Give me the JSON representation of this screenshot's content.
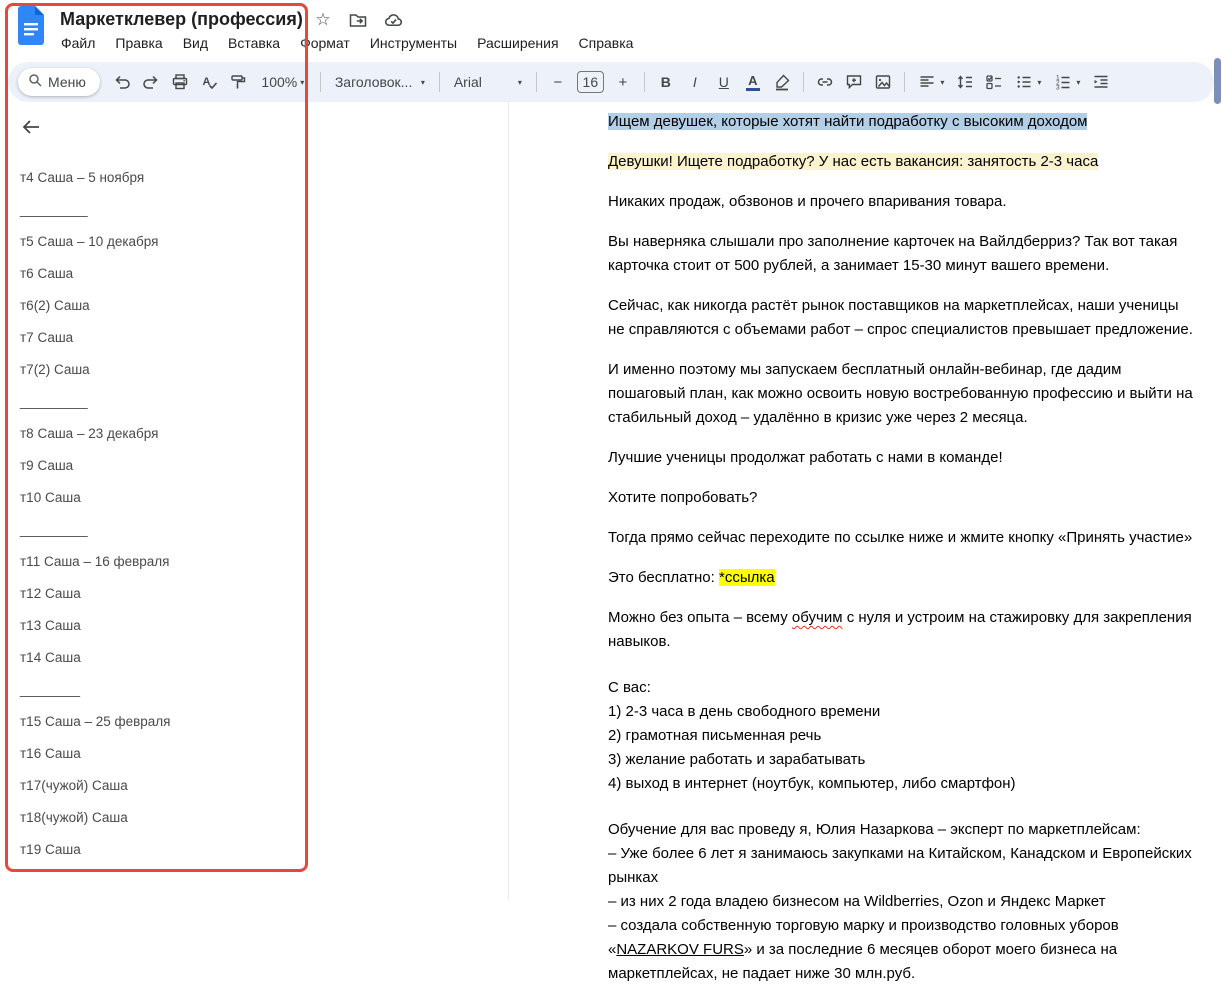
{
  "window": {
    "title": "Маркетклевер (профессия)"
  },
  "menu": {
    "items": [
      "Файл",
      "Правка",
      "Вид",
      "Вставка",
      "Формат",
      "Инструменты",
      "Расширения",
      "Справка"
    ]
  },
  "toolbar": {
    "menu_label": "Меню",
    "zoom": "100%",
    "style_name": "Заголовок...",
    "font_name": "Arial",
    "font_size": "16"
  },
  "outline": {
    "items": [
      "т4 Саша – 5 ноября",
      "_________",
      "т5 Саша – 10 декабря",
      "т6 Саша",
      "т6(2) Саша",
      "т7 Саша",
      "т7(2) Саша",
      "_________",
      "т8 Саша – 23 декабря",
      "т9 Саша",
      "т10 Саша",
      "_________",
      "т11 Саша – 16 февраля",
      "т12 Саша",
      "т13 Саша",
      "т14 Саша",
      "________",
      "т15 Саша – 25 февраля",
      "т16 Саша",
      "т17(чужой) Саша",
      "т18(чужой) Саша",
      "т19 Саша"
    ]
  },
  "document": {
    "paragraphs": [
      {
        "gap": false,
        "segments": [
          {
            "text": "Ищем девушек, которые хотят найти подработку с высоким доходом",
            "style": "sel"
          }
        ]
      },
      {
        "gap": false,
        "segments": [
          {
            "text": "Девушки! Ищете подработку? У нас есть вакансия: занятость 2-3 часа",
            "style": "pale"
          }
        ]
      },
      {
        "gap": false,
        "segments": [
          {
            "text": "Никаких продаж, обзвонов и прочего впаривания товара.",
            "style": "plain"
          }
        ]
      },
      {
        "gap": false,
        "segments": [
          {
            "text": "Вы наверняка слышали про заполнение карточек на Вайлдберриз? Так вот такая карточка стоит от 500 рублей, а занимает 15-30 минут вашего времени.",
            "style": "plain"
          }
        ]
      },
      {
        "gap": false,
        "segments": [
          {
            "text": "Сейчас, как никогда растёт рынок поставщиков на маркетплейсах, наши ученицы не справляются с объемами работ – спрос специалистов превышает предложение.",
            "style": "plain"
          }
        ]
      },
      {
        "gap": false,
        "segments": [
          {
            "text": "И именно поэтому мы запускаем бесплатный онлайн-вебинар, где дадим пошаговый план, как можно освоить новую востребованную профессию и выйти на стабильный доход – удалённо в кризис уже через 2 месяца.",
            "style": "plain"
          }
        ]
      },
      {
        "gap": false,
        "segments": [
          {
            "text": "Лучшие ученицы продолжат работать с нами в команде!",
            "style": "plain"
          }
        ]
      },
      {
        "gap": false,
        "segments": [
          {
            "text": "Хотите попробовать?",
            "style": "plain"
          }
        ]
      },
      {
        "gap": false,
        "segments": [
          {
            "text": "Тогда прямо сейчас переходите по ссылке ниже и жмите кнопку «Принять участие»",
            "style": "plain"
          }
        ]
      },
      {
        "gap": false,
        "segments": [
          {
            "text": "Это бесплатно: ",
            "style": "plain"
          },
          {
            "text": "*ссылка",
            "style": "bright"
          }
        ]
      },
      {
        "gap": false,
        "segments": [
          {
            "text": "Можно без опыта – всему ",
            "style": "plain"
          },
          {
            "text": "обучим",
            "style": "spell"
          },
          {
            "text": " с нуля и устроим на стажировку для закрепления навыков.",
            "style": "plain"
          }
        ]
      },
      {
        "gap": true,
        "segments": [
          {
            "text": "С вас:\n1) 2-3 часа в день свободного времени\n2) грамотная письменная речь\n3) желание работать и зарабатывать\n4) выход в интернет (ноутбук, компьютер, либо смартфон)",
            "style": "plain"
          }
        ]
      },
      {
        "gap": true,
        "segments": [
          {
            "text": "Обучение для вас проведу я, Юлия Назаркова – эксперт по маркетплейсам:\n– Уже более 6 лет я занимаюсь закупками на Китайском, Канадском и Европейских рынках\n– из них 2 года владею бизнесом на Wildberries, Ozon и Яндекс Маркет\n– создала собственную торговую марку и производство головных уборов «",
            "style": "plain"
          },
          {
            "text": "NAZARKOV FURS",
            "style": "und"
          },
          {
            "text": "» и за последние 6 месяцев оборот моего бизнеса на маркетплейсах, не падает ниже 30 млн.руб.",
            "style": "plain"
          }
        ]
      }
    ]
  },
  "colors": {
    "selection_highlight": "#b3cfe8",
    "pale_highlight": "#fbf3cd",
    "bright_highlight": "#ffff00",
    "annotation": "#e5493a",
    "toolbar_bg": "#edf2fa",
    "scrollbar_thumb": "#7b8fb8"
  }
}
